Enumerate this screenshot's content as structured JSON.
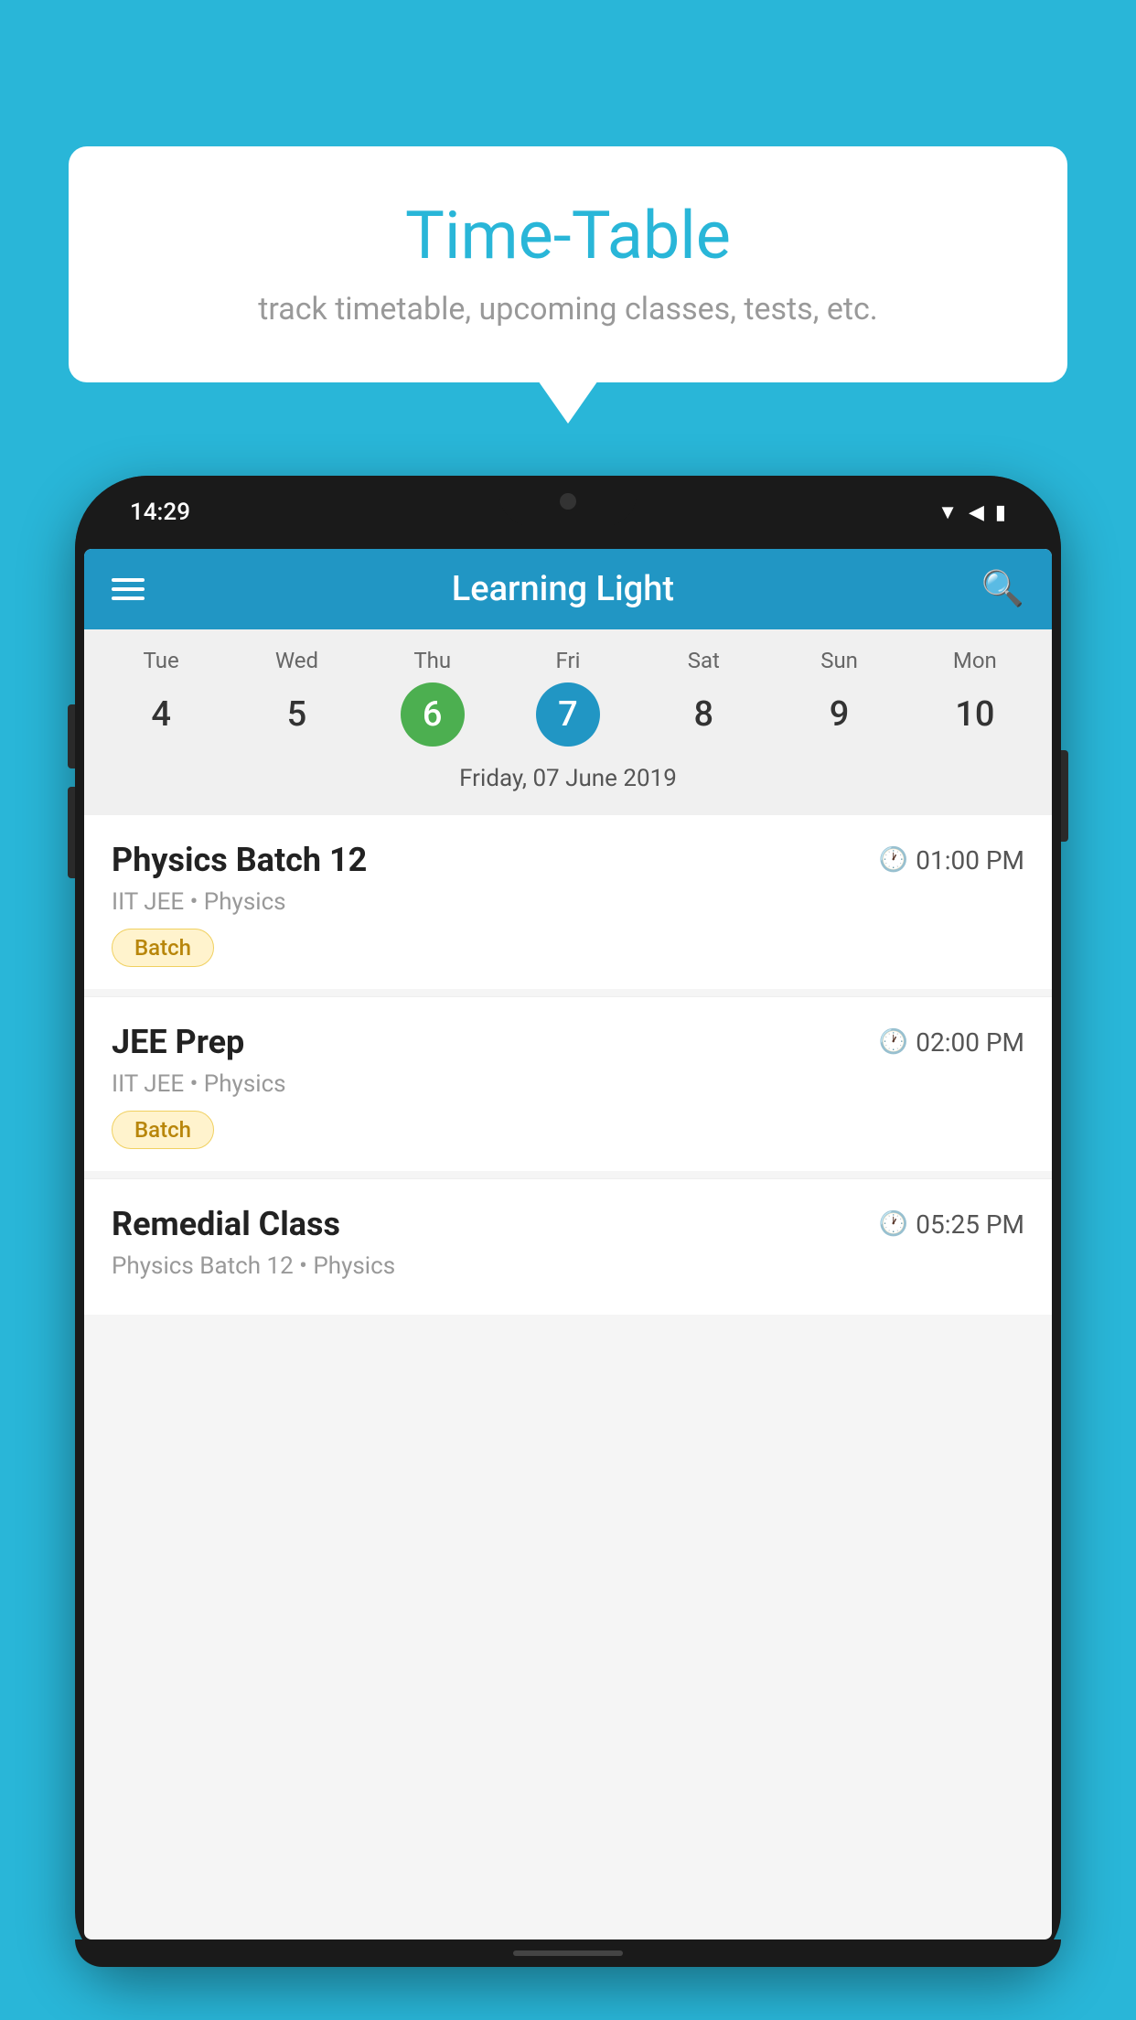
{
  "background_color": "#29B6D8",
  "bubble": {
    "title": "Time-Table",
    "subtitle": "track timetable, upcoming classes, tests, etc."
  },
  "phone": {
    "status_bar": {
      "time": "14:29"
    },
    "app_header": {
      "title": "Learning Light"
    },
    "calendar": {
      "days_of_week": [
        "Tue",
        "Wed",
        "Thu",
        "Fri",
        "Sat",
        "Sun",
        "Mon"
      ],
      "dates": [
        "4",
        "5",
        "6",
        "7",
        "8",
        "9",
        "10"
      ],
      "today_index": 2,
      "selected_index": 3,
      "selected_date_label": "Friday, 07 June 2019"
    },
    "classes": [
      {
        "name": "Physics Batch 12",
        "time": "01:00 PM",
        "subject": "IIT JEE • Physics",
        "tag": "Batch"
      },
      {
        "name": "JEE Prep",
        "time": "02:00 PM",
        "subject": "IIT JEE • Physics",
        "tag": "Batch"
      },
      {
        "name": "Remedial Class",
        "time": "05:25 PM",
        "subject": "Physics Batch 12 • Physics",
        "tag": null
      }
    ]
  }
}
